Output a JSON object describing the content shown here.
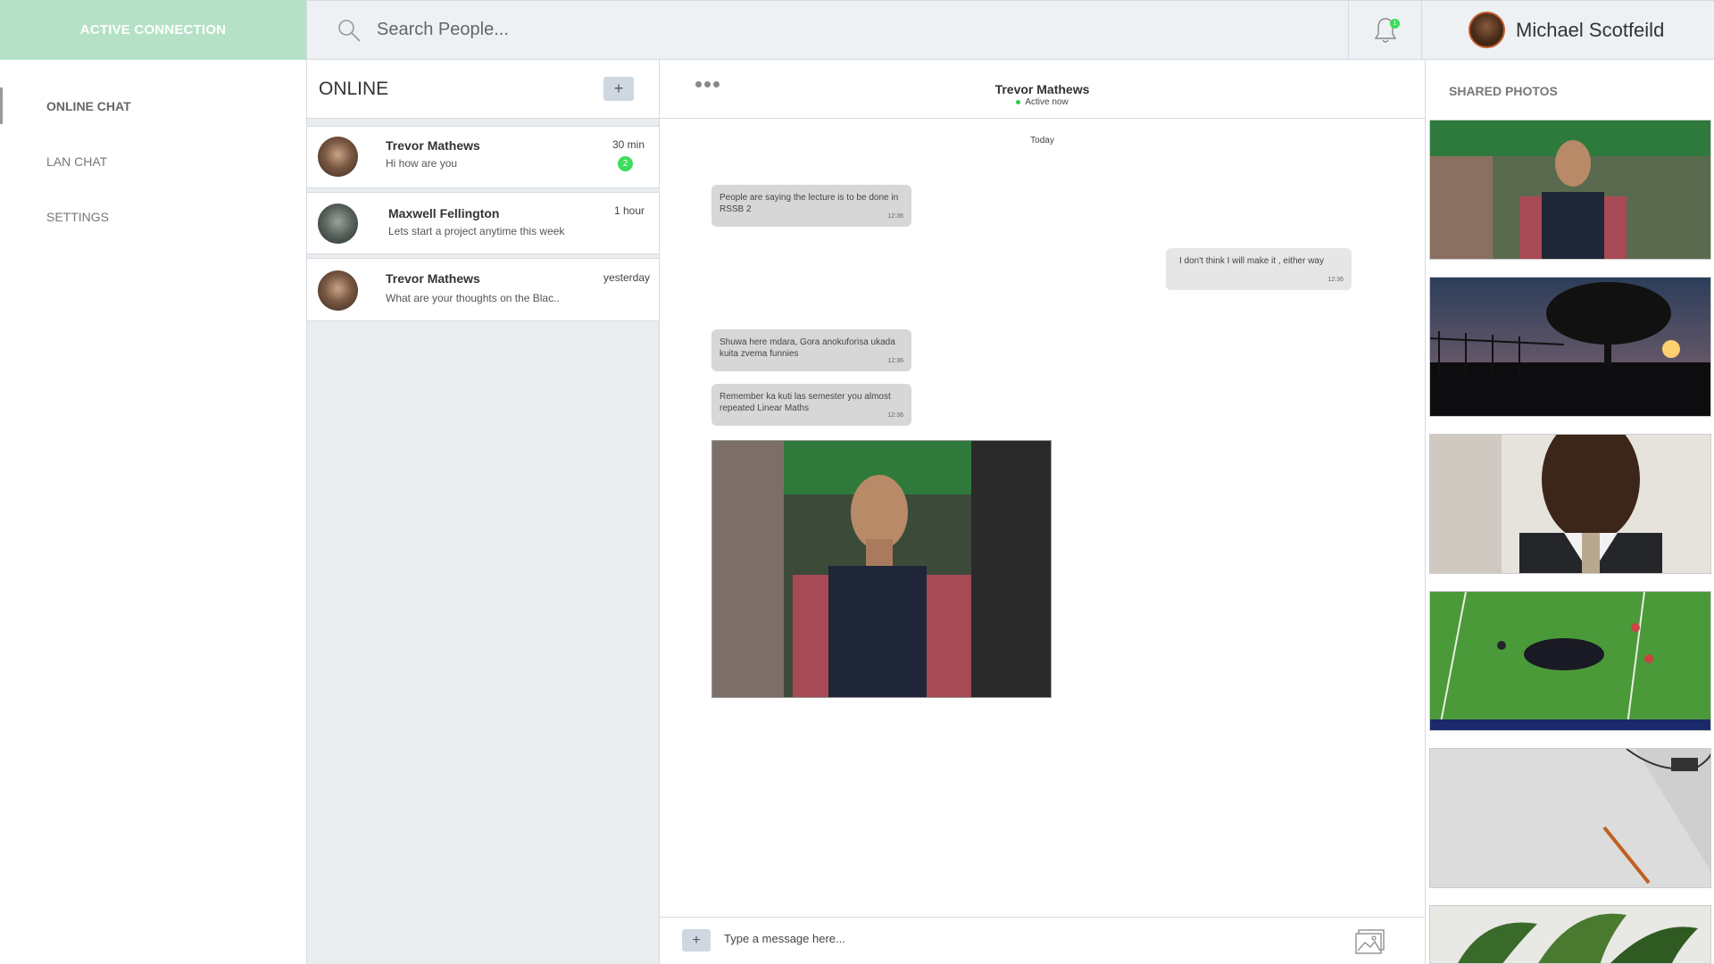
{
  "brand": {
    "label": "ACTIVE CONNECTION"
  },
  "search": {
    "placeholder": "Search People..."
  },
  "notifications": {
    "count": "1"
  },
  "user": {
    "name": "Michael Scotfeild"
  },
  "nav": {
    "items": [
      {
        "label": "ONLINE CHAT",
        "active": true
      },
      {
        "label": "LAN CHAT",
        "active": false
      },
      {
        "label": "SETTINGS",
        "active": false
      }
    ]
  },
  "contacts": {
    "title": "ONLINE",
    "add_label": "+",
    "items": [
      {
        "name": "Trevor Mathews",
        "message": "Hi how are you",
        "time": "30 min",
        "unread": "2"
      },
      {
        "name": "Maxwell Fellington",
        "message": "Lets start a project anytime this week",
        "time": "1 hour"
      },
      {
        "name": "Trevor Mathews",
        "message": "What are your thoughts on the Blac..",
        "time": "yesterday"
      }
    ]
  },
  "chat": {
    "name": "Trevor Mathews",
    "status": "Active now",
    "day": "Today",
    "messages": [
      {
        "text": "People are saying the lecture is to be done in RSSB 2",
        "time": "12:36",
        "direction": "in"
      },
      {
        "text": "I don't think I will make it , either way",
        "time": "12:36",
        "direction": "out"
      },
      {
        "text": "Shuwa here mdara, Gora anokuforisa ukada kuita zvema funnies",
        "time": "12:36",
        "direction": "in"
      },
      {
        "text": "Remember ka kuti las semester you almost repeated Linear Maths",
        "time": "12:36",
        "direction": "in"
      }
    ],
    "composer": {
      "placeholder": "Type a message here...",
      "add_label": "+"
    }
  },
  "shared": {
    "title": "SHARED PHOTOS"
  },
  "colors": {
    "accent": "#b5e1c6",
    "online": "#3ddc5c",
    "panel": "#e9edf0"
  }
}
